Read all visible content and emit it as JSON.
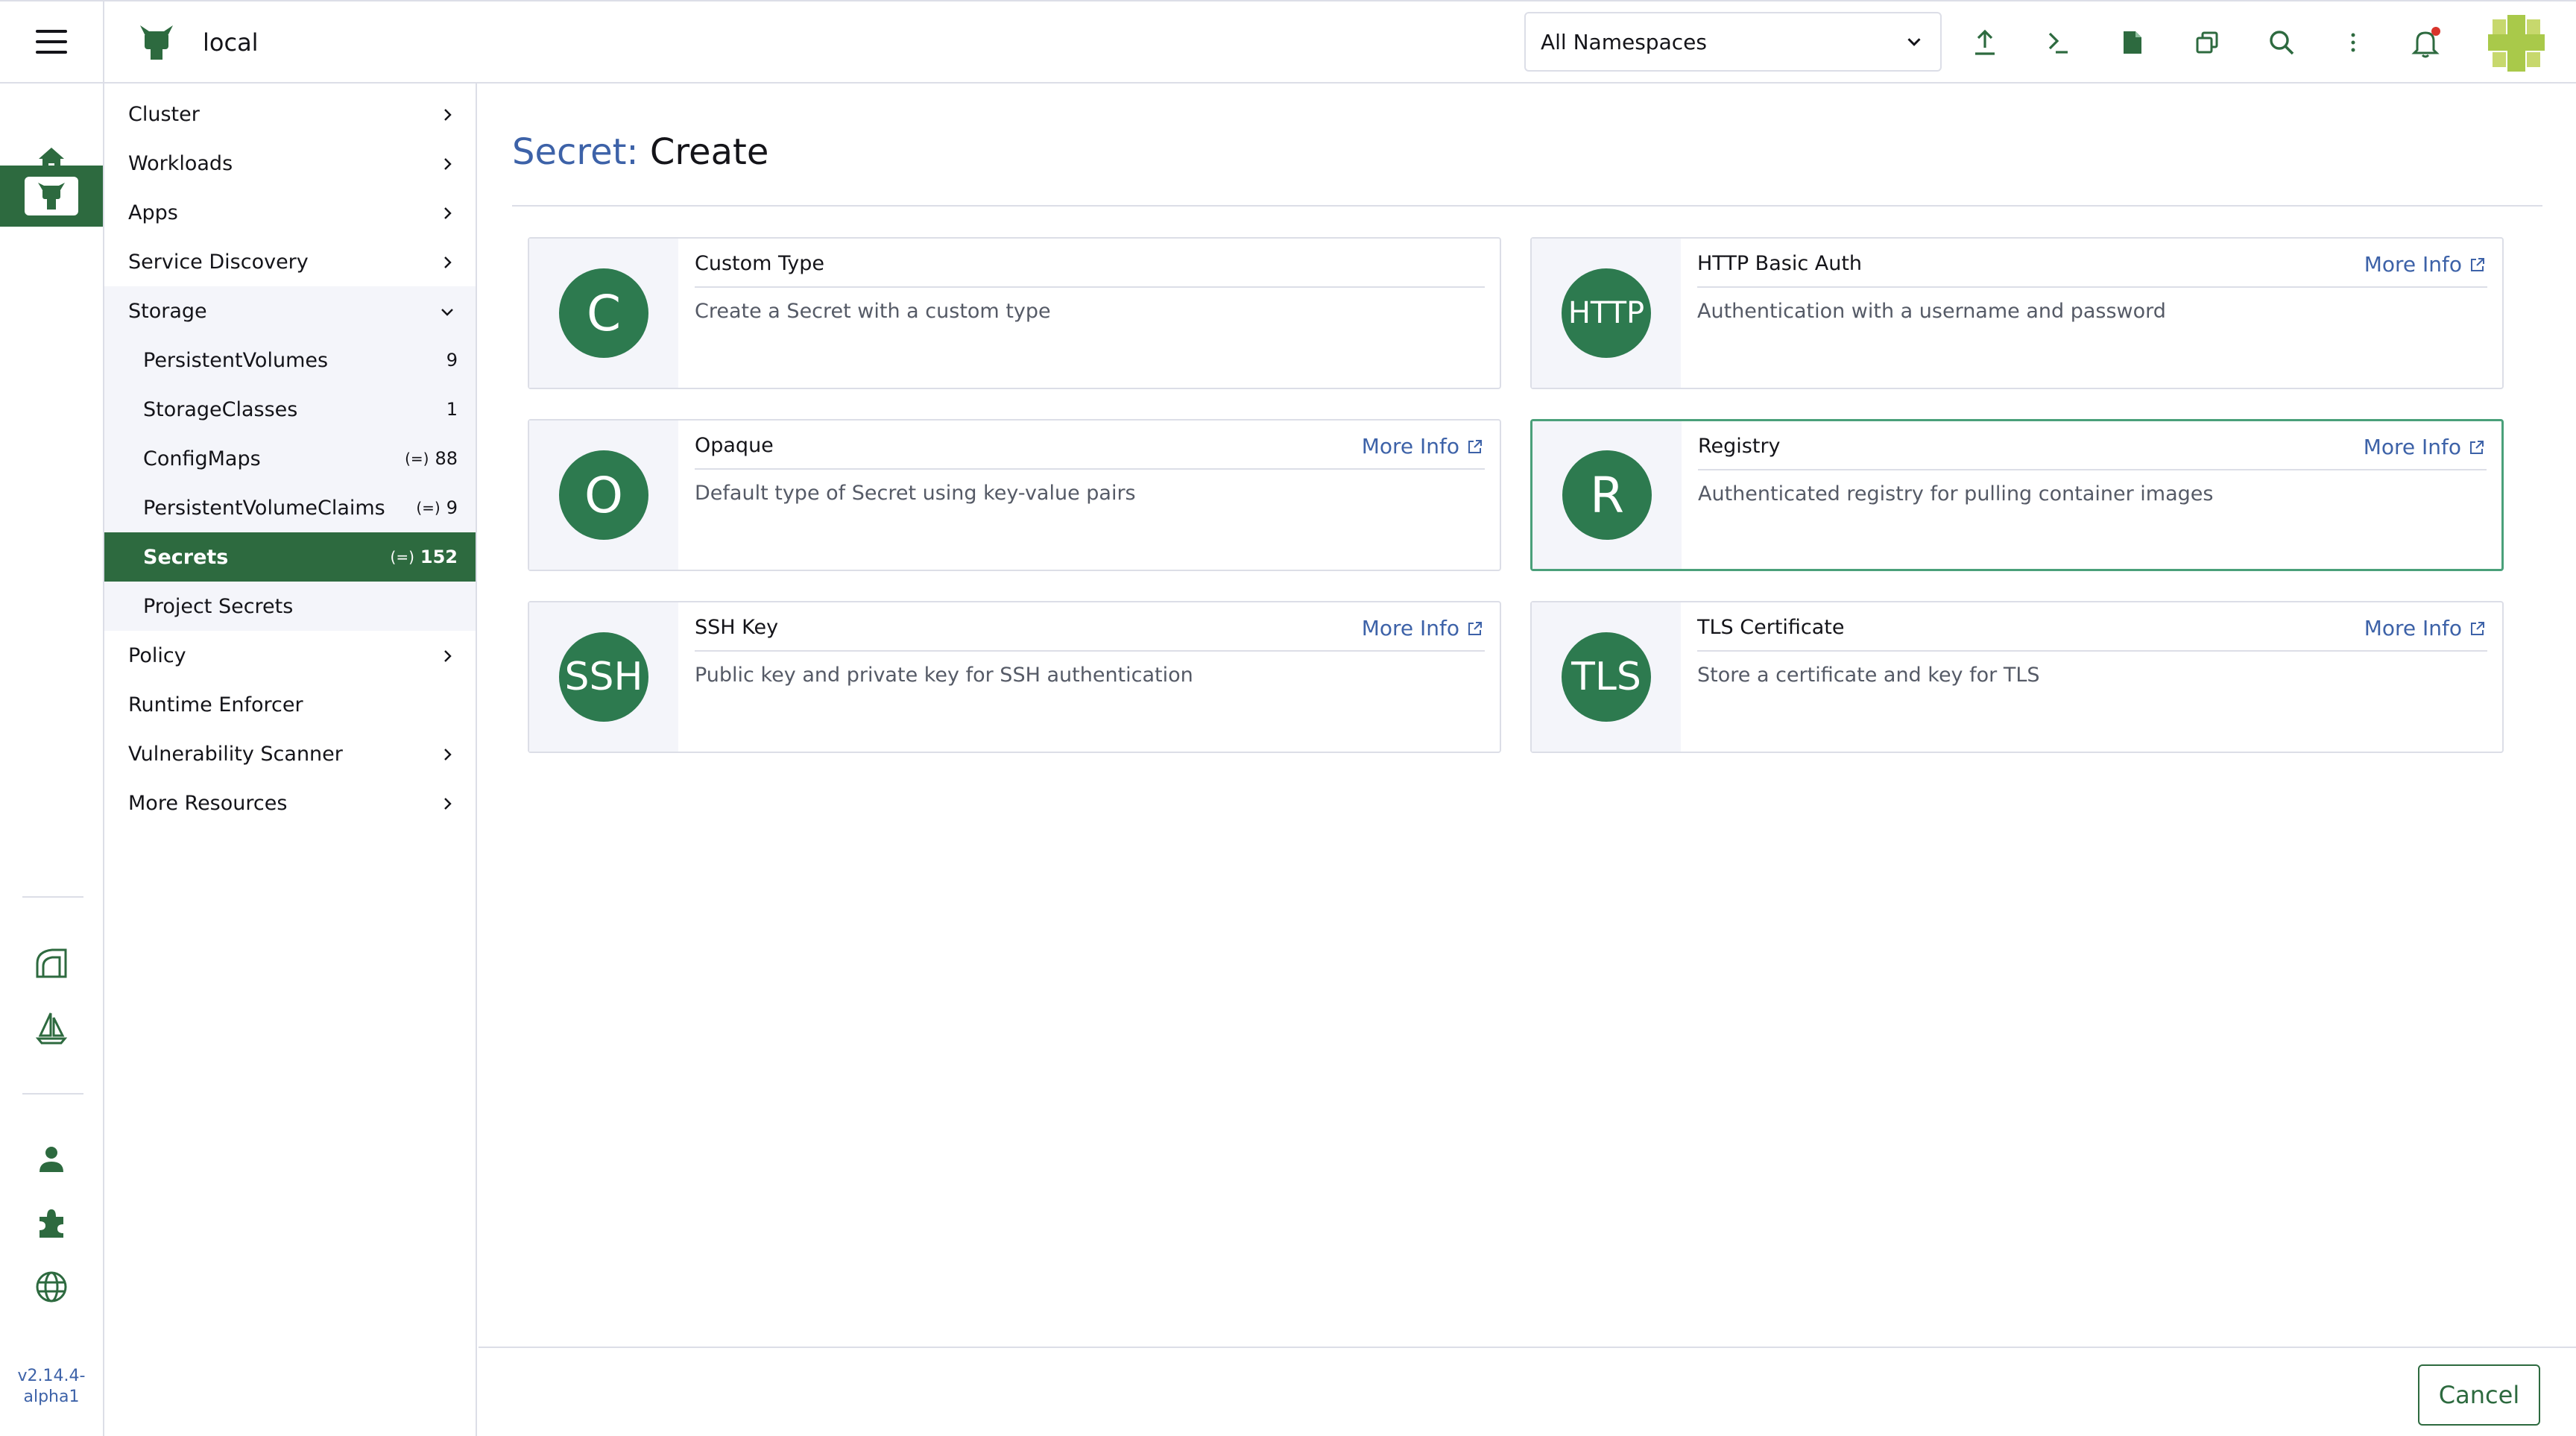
{
  "header": {
    "cluster_name": "local",
    "namespace_select": "All Namespaces",
    "icons": [
      "import-yaml-icon",
      "kubectl-shell-icon",
      "kubeconfig-download-icon",
      "copy-kubeconfig-icon",
      "resource-search-icon",
      "more-actions-icon",
      "notifications-icon"
    ],
    "notification_badge_color": "#d9342b"
  },
  "rail": {
    "items": [
      "home-icon",
      "cluster-explorer-icon",
      "fleet-icon",
      "sail-icon",
      "users-icon",
      "extensions-icon",
      "global-settings-icon"
    ],
    "version_line1": "v2.14.4-",
    "version_line2": "alpha1"
  },
  "nav": {
    "cluster": "Cluster",
    "workloads": "Workloads",
    "apps": "Apps",
    "service_discovery": "Service Discovery",
    "storage": "Storage",
    "storage_items": [
      {
        "label": "PersistentVolumes",
        "count": "9"
      },
      {
        "label": "StorageClasses",
        "count": "1"
      },
      {
        "label": "ConfigMaps",
        "count": "88"
      },
      {
        "label": "PersistentVolumeClaims",
        "count": "9"
      },
      {
        "label": "Secrets",
        "count": "152"
      },
      {
        "label": "Project Secrets",
        "count": ""
      }
    ],
    "policy": "Policy",
    "runtime_enforcer": "Runtime Enforcer",
    "vulnerability_scanner": "Vulnerability Scanner",
    "more_resources": "More Resources"
  },
  "page": {
    "title_prefix": "Secret:",
    "title_main": "Create"
  },
  "cards": [
    {
      "letter": "C",
      "title": "Custom Type",
      "desc": "Create a Secret with a custom type",
      "more": ""
    },
    {
      "letter": "HTTP",
      "title": "HTTP Basic Auth",
      "desc": "Authentication with a username and password",
      "more": "More Info"
    },
    {
      "letter": "O",
      "title": "Opaque",
      "desc": "Default type of Secret using key-value pairs",
      "more": "More Info"
    },
    {
      "letter": "R",
      "title": "Registry",
      "desc": "Authenticated registry for pulling container images",
      "more": "More Info"
    },
    {
      "letter": "SSH",
      "title": "SSH Key",
      "desc": "Public key and private key for SSH authentication",
      "more": "More Info"
    },
    {
      "letter": "TLS",
      "title": "TLS Certificate",
      "desc": "Store a certificate and key for TLS",
      "more": "More Info"
    }
  ],
  "footer": {
    "cancel": "Cancel"
  },
  "colors": {
    "brand_green": "#2d6a3f",
    "link_blue": "#3d62a8"
  }
}
